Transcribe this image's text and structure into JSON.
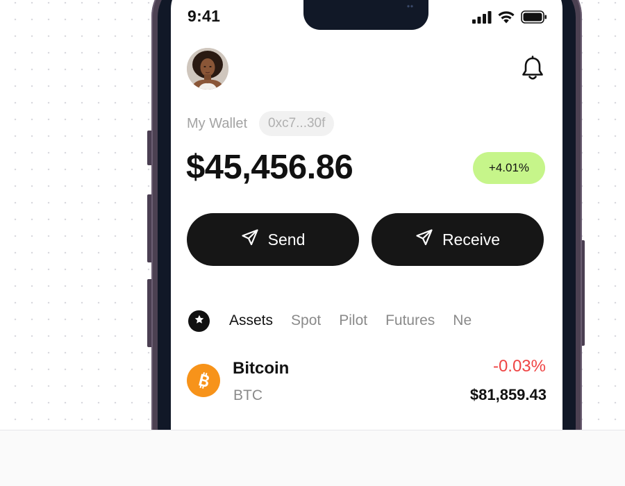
{
  "status_bar": {
    "time": "9:41",
    "icons": [
      "signal-bars-icon",
      "wifi-icon",
      "battery-icon"
    ]
  },
  "header": {
    "avatar": "user-avatar",
    "notification_icon": "bell-icon"
  },
  "wallet": {
    "label": "My Wallet",
    "address": "0xc7...30f",
    "balance": "$45,456.86",
    "change": "+4.01%",
    "change_color": "#c6f58a"
  },
  "actions": {
    "send_label": "Send",
    "send_icon": "paper-plane-icon",
    "receive_label": "Receive",
    "receive_icon": "paper-plane-icon"
  },
  "tabs": {
    "favorite_icon": "star-icon",
    "items": [
      {
        "label": "Assets",
        "active": true
      },
      {
        "label": "Spot",
        "active": false
      },
      {
        "label": "Pilot",
        "active": false
      },
      {
        "label": "Futures",
        "active": false
      },
      {
        "label": "Ne",
        "active": false
      }
    ]
  },
  "assets": [
    {
      "name": "Bitcoin",
      "symbol": "BTC",
      "change": "-0.03%",
      "price": "$81,859.43",
      "icon": "bitcoin-icon",
      "icon_color": "#f7931a",
      "change_color": "#ef4444"
    }
  ],
  "colors": {
    "button_bg": "#161616",
    "frame": "#4c4152",
    "accent_green": "#c6f58a",
    "negative_red": "#ef4444"
  }
}
